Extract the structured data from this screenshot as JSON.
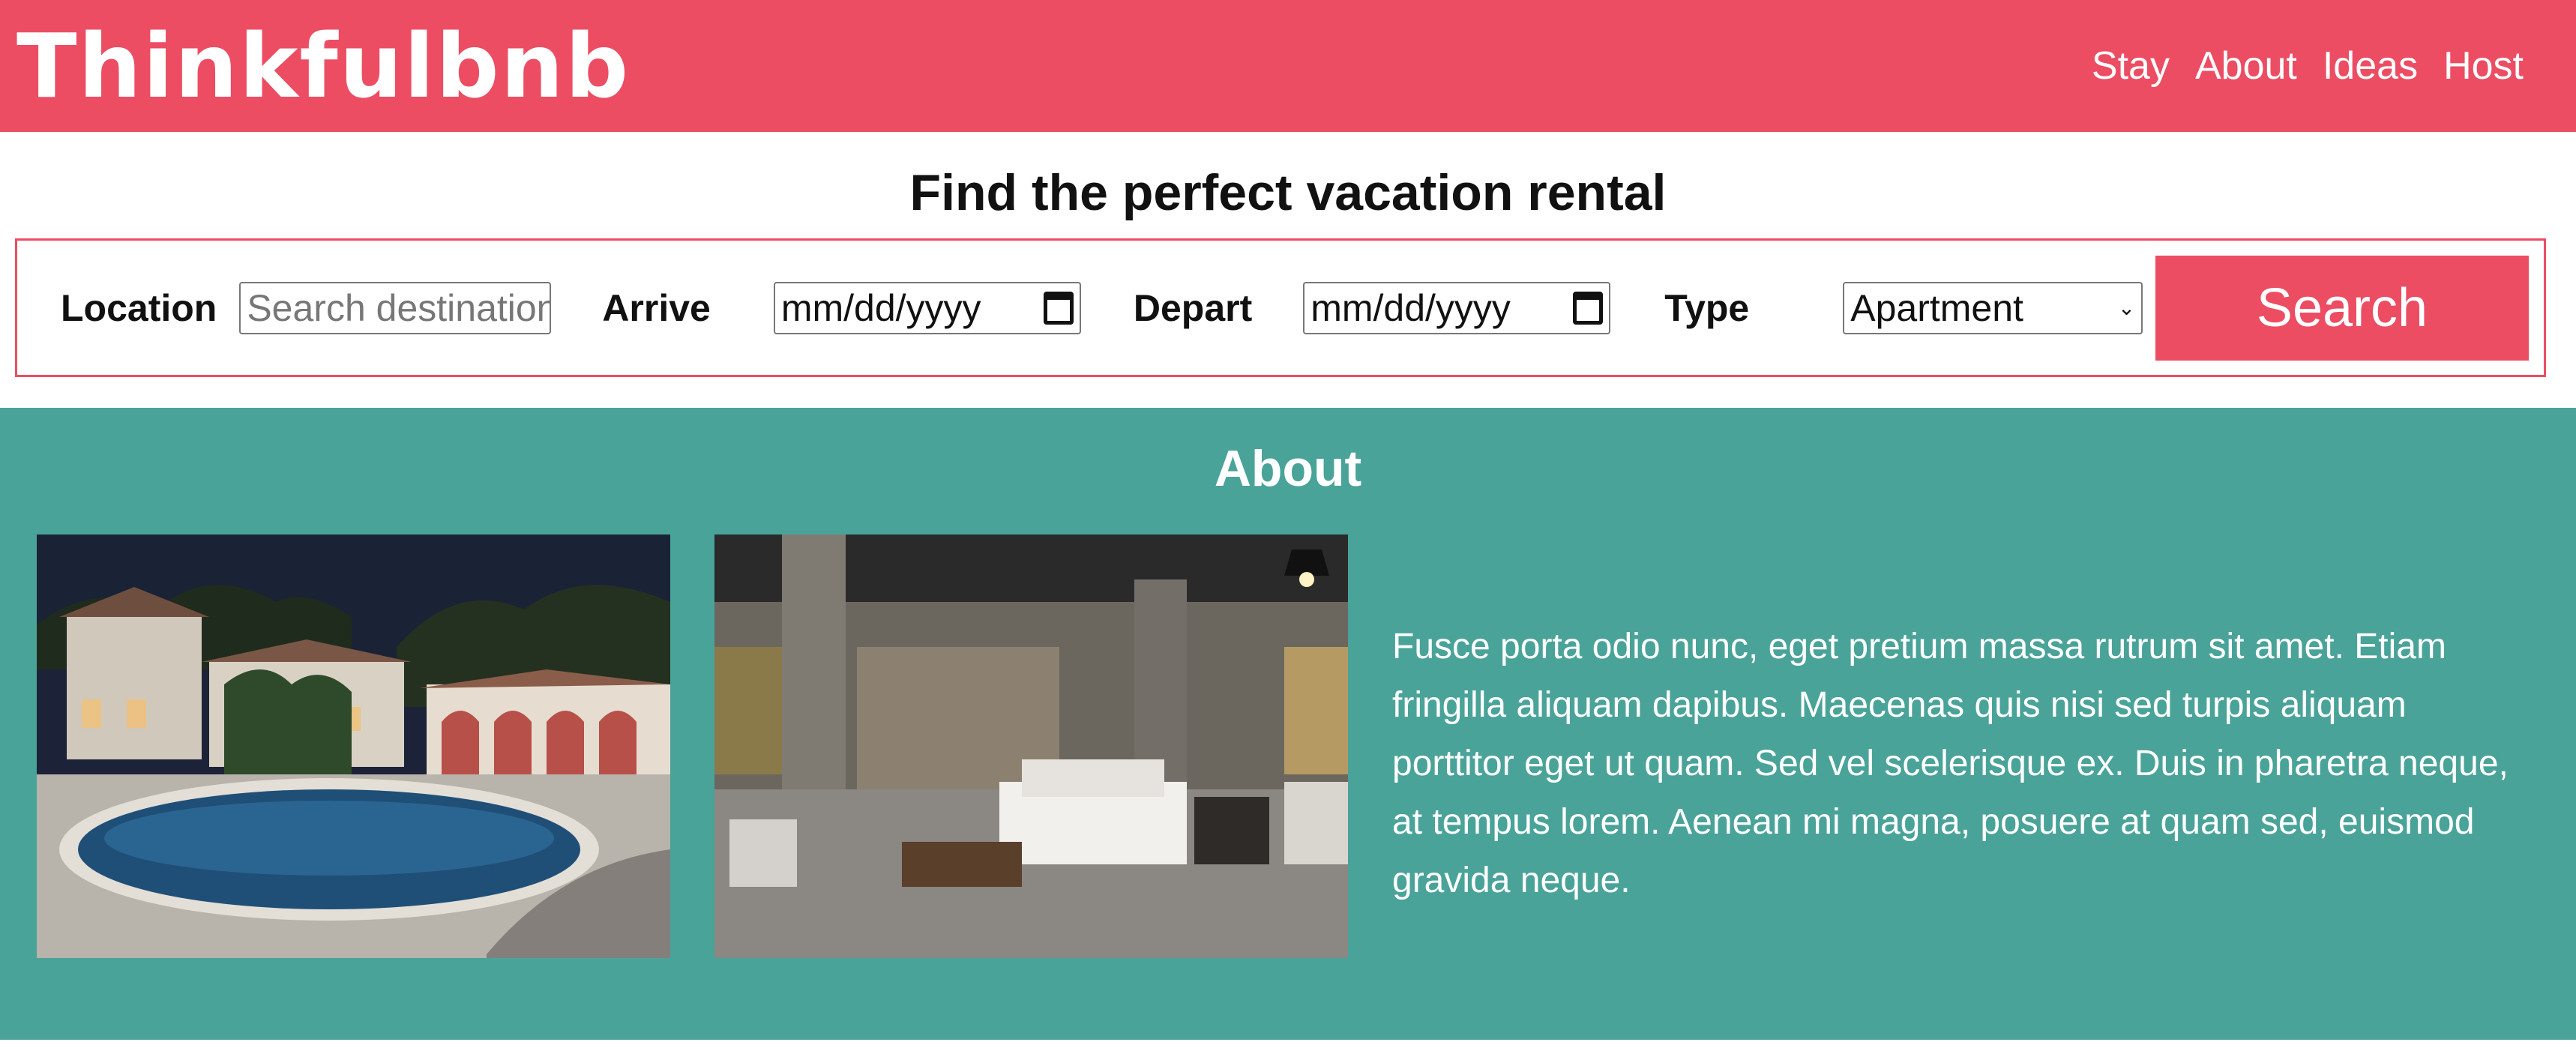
{
  "header": {
    "brand": "Thinkfulbnb",
    "nav": [
      "Stay",
      "About",
      "Ideas",
      "Host"
    ],
    "color": "#ec4d63"
  },
  "search": {
    "title": "Find the perfect vacation rental",
    "location_label": "Location",
    "location_placeholder": "Search destinations",
    "arrive_label": "Arrive",
    "arrive_value": "mm/dd/yyyy",
    "depart_label": "Depart",
    "depart_value": "mm/dd/yyyy",
    "type_label": "Type",
    "type_value": "Apartment",
    "button_label": "Search",
    "calendar_icon": "calendar-icon"
  },
  "about": {
    "title": "About",
    "background": "#4aa399",
    "photos": [
      "pool-villa-night-photo",
      "loft-bedroom-photo"
    ],
    "text": "Fusce porta odio nunc, eget pretium massa rutrum sit amet. Etiam fringilla aliquam dapibus. Maecenas quis nisi sed turpis aliquam porttitor eget ut quam. Sed vel scelerisque ex. Duis in pharetra neque, at tempus lorem. Aenean mi magna, posuere at quam sed, euismod gravida neque."
  }
}
